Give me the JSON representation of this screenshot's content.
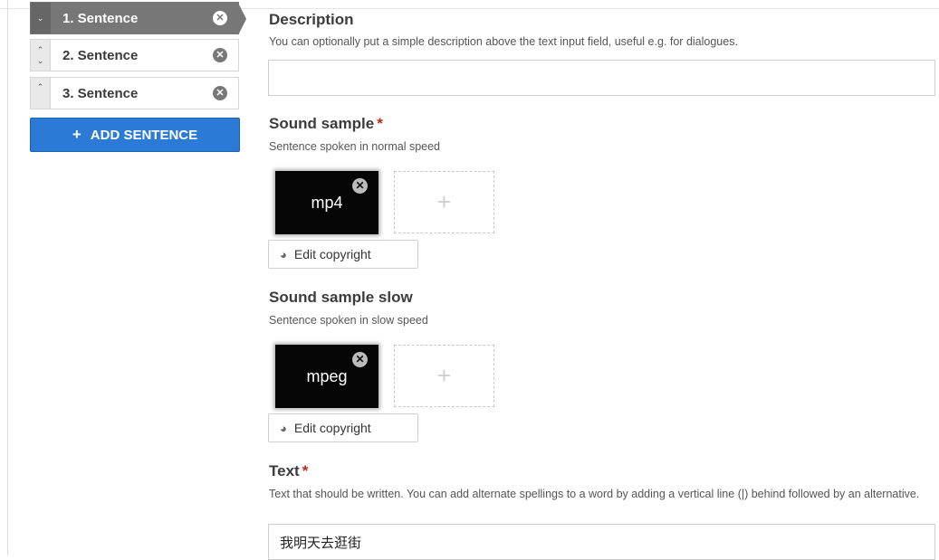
{
  "sentences": [
    {
      "label": "1. Sentence",
      "active": true
    },
    {
      "label": "2. Sentence",
      "active": false
    },
    {
      "label": "3. Sentence",
      "active": false
    }
  ],
  "add_sentence_label": "ADD SENTENCE",
  "fields": {
    "description": {
      "title": "Description",
      "help": "You can optionally put a simple description above the text input field, useful e.g. for dialogues.",
      "value": ""
    },
    "sound_sample": {
      "title": "Sound sample",
      "required_mark": "*",
      "help": "Sentence spoken in normal speed",
      "file_type": "mp4",
      "edit_copyright_label": "Edit copyright"
    },
    "sound_sample_slow": {
      "title": "Sound sample slow",
      "help": "Sentence spoken in slow speed",
      "file_type": "mpeg",
      "edit_copyright_label": "Edit copyright"
    },
    "text": {
      "title": "Text",
      "required_mark": "*",
      "help": "Text that should be written. You can add alternate spellings to a word by adding a vertical line (|) behind followed by an alternative.",
      "value": "我明天去逛街"
    }
  },
  "icons": {
    "remove": "close-circle-icon",
    "add": "plus-icon",
    "copyright": "copyright-icon",
    "move_up": "chevron-up-icon",
    "move_down": "chevron-down-icon"
  },
  "colors": {
    "primary_button": "#2b7ad6",
    "active_item": "#777777",
    "required": "#c0281c"
  }
}
